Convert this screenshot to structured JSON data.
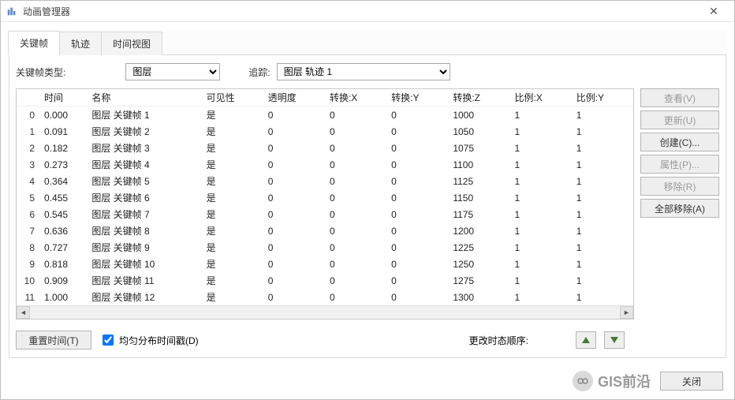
{
  "window": {
    "title": "动画管理器"
  },
  "tabs": [
    {
      "label": "关键帧",
      "active": true
    },
    {
      "label": "轨迹",
      "active": false
    },
    {
      "label": "时间视图",
      "active": false
    }
  ],
  "controls": {
    "type_label": "关键帧类型:",
    "type_value": "图层",
    "track_label": "追踪:",
    "track_value": "图层 轨迹 1"
  },
  "columns": {
    "time": "时间",
    "name": "名称",
    "visible": "可见性",
    "transparency": "透明度",
    "convX": "转换:X",
    "convY": "转换:Y",
    "convZ": "转换:Z",
    "scaleX": "比例:X",
    "scaleY": "比例:Y"
  },
  "rows": [
    {
      "idx": 0,
      "time": "0.000",
      "name": "图层 关键帧 1",
      "visible": "是",
      "transparency": 0,
      "cx": 0,
      "cy": 0,
      "cz": 1000,
      "sx": 1,
      "sy": 1
    },
    {
      "idx": 1,
      "time": "0.091",
      "name": "图层 关键帧 2",
      "visible": "是",
      "transparency": 0,
      "cx": 0,
      "cy": 0,
      "cz": 1050,
      "sx": 1,
      "sy": 1
    },
    {
      "idx": 2,
      "time": "0.182",
      "name": "图层 关键帧 3",
      "visible": "是",
      "transparency": 0,
      "cx": 0,
      "cy": 0,
      "cz": 1075,
      "sx": 1,
      "sy": 1
    },
    {
      "idx": 3,
      "time": "0.273",
      "name": "图层 关键帧 4",
      "visible": "是",
      "transparency": 0,
      "cx": 0,
      "cy": 0,
      "cz": 1100,
      "sx": 1,
      "sy": 1
    },
    {
      "idx": 4,
      "time": "0.364",
      "name": "图层 关键帧 5",
      "visible": "是",
      "transparency": 0,
      "cx": 0,
      "cy": 0,
      "cz": 1125,
      "sx": 1,
      "sy": 1
    },
    {
      "idx": 5,
      "time": "0.455",
      "name": "图层 关键帧 6",
      "visible": "是",
      "transparency": 0,
      "cx": 0,
      "cy": 0,
      "cz": 1150,
      "sx": 1,
      "sy": 1
    },
    {
      "idx": 6,
      "time": "0.545",
      "name": "图层 关键帧 7",
      "visible": "是",
      "transparency": 0,
      "cx": 0,
      "cy": 0,
      "cz": 1175,
      "sx": 1,
      "sy": 1
    },
    {
      "idx": 7,
      "time": "0.636",
      "name": "图层 关键帧 8",
      "visible": "是",
      "transparency": 0,
      "cx": 0,
      "cy": 0,
      "cz": 1200,
      "sx": 1,
      "sy": 1
    },
    {
      "idx": 8,
      "time": "0.727",
      "name": "图层 关键帧 9",
      "visible": "是",
      "transparency": 0,
      "cx": 0,
      "cy": 0,
      "cz": 1225,
      "sx": 1,
      "sy": 1
    },
    {
      "idx": 9,
      "time": "0.818",
      "name": "图层 关键帧 10",
      "visible": "是",
      "transparency": 0,
      "cx": 0,
      "cy": 0,
      "cz": 1250,
      "sx": 1,
      "sy": 1
    },
    {
      "idx": 10,
      "time": "0.909",
      "name": "图层 关键帧 11",
      "visible": "是",
      "transparency": 0,
      "cx": 0,
      "cy": 0,
      "cz": 1275,
      "sx": 1,
      "sy": 1
    },
    {
      "idx": 11,
      "time": "1.000",
      "name": "图层 关键帧 12",
      "visible": "是",
      "transparency": 0,
      "cx": 0,
      "cy": 0,
      "cz": 1300,
      "sx": 1,
      "sy": 1
    }
  ],
  "side_buttons": {
    "view": "查看(V)",
    "update": "更新(U)",
    "create": "创建(C)...",
    "props": "属性(P)...",
    "remove": "移除(R)",
    "remove_all": "全部移除(A)"
  },
  "bottom": {
    "reset_time": "重置时间(T)",
    "even_dist": "均匀分布时间戳(D)",
    "change_order": "更改时态顺序:"
  },
  "footer": {
    "watermark": "GIS前沿",
    "close": "关闭"
  }
}
